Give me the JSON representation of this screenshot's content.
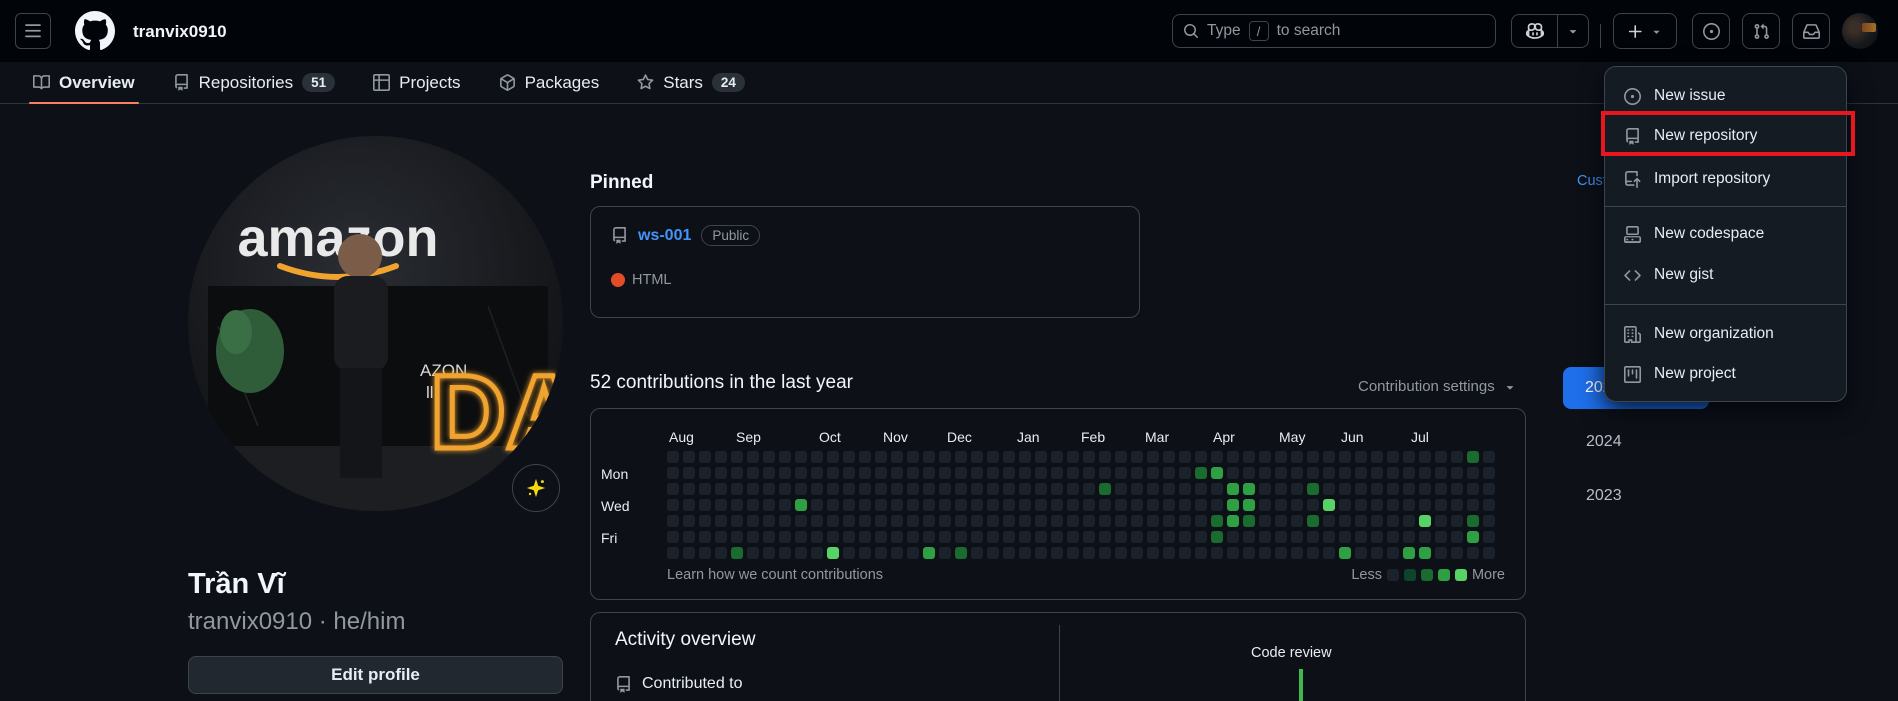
{
  "colors": {
    "page_bg": "#0d1117",
    "header_bg": "#010409",
    "border": "#3d444d",
    "link_blue": "#4493f8",
    "primary_blue": "#1f6feb",
    "tab_accent_orange": "#f78166",
    "html_lang_dot": "#e34c26",
    "highlight_red": "#e8161f",
    "code_review_green": "#3fb950"
  },
  "header": {
    "username": "tranvix0910",
    "search": {
      "prefix": "Type",
      "slash_key": "/",
      "suffix": "to search"
    },
    "icons": [
      "three-bars-icon",
      "github-mark-icon",
      "search-icon",
      "copilot-icon",
      "chevron-down-icon",
      "plus-icon",
      "issue-opened-icon",
      "git-pull-request-icon",
      "inbox-icon",
      "avatar"
    ]
  },
  "tabs": [
    {
      "label": "Overview",
      "icon": "book-icon",
      "active": true
    },
    {
      "label": "Repositories",
      "icon": "repo-icon",
      "count": "51",
      "active": false
    },
    {
      "label": "Projects",
      "icon": "table-icon",
      "active": false
    },
    {
      "label": "Packages",
      "icon": "package-icon",
      "active": false
    },
    {
      "label": "Stars",
      "icon": "star-icon",
      "count": "24",
      "active": false
    }
  ],
  "profile": {
    "name": "Trần Vĩ",
    "login_line": "tranvix0910 · he/him",
    "edit_button": "Edit profile",
    "status_icon": "sparkle-icon",
    "avatar_scene": {
      "brand_text": "amazon",
      "neon_text": "DA",
      "small_text": "AZON,",
      "small_text2": "ll"
    }
  },
  "pinned": {
    "title": "Pinned",
    "repo": {
      "name": "ws-001",
      "visibility": "Public",
      "language": "HTML",
      "language_color": "#e34c26"
    }
  },
  "contributions": {
    "title": "52 contributions in the last year",
    "settings_label": "Contribution settings",
    "months": [
      "Aug",
      "Sep",
      "Oct",
      "Nov",
      "Dec",
      "Jan",
      "Feb",
      "Mar",
      "Apr",
      "May",
      "Jun",
      "Jul"
    ],
    "day_labels": [
      "Mon",
      "Wed",
      "Fri"
    ],
    "footer_link": "Learn how we count contributions",
    "legend": {
      "less": "Less",
      "more": "More"
    },
    "level_colors": [
      "#1b222c",
      "#0e4429",
      "#196c2e",
      "#2ea043",
      "#56d364"
    ],
    "grid": {
      "weeks": 52,
      "days": 7,
      "cells": [
        {
          "week": 4,
          "day": 6,
          "level": 2
        },
        {
          "week": 8,
          "day": 3,
          "level": 3
        },
        {
          "week": 10,
          "day": 6,
          "level": 4
        },
        {
          "week": 16,
          "day": 6,
          "level": 3
        },
        {
          "week": 18,
          "day": 6,
          "level": 2
        },
        {
          "week": 27,
          "day": 2,
          "level": 2
        },
        {
          "week": 33,
          "day": 1,
          "level": 2
        },
        {
          "week": 34,
          "day": 1,
          "level": 3
        },
        {
          "week": 34,
          "day": 4,
          "level": 2
        },
        {
          "week": 34,
          "day": 5,
          "level": 2
        },
        {
          "week": 35,
          "day": 2,
          "level": 3
        },
        {
          "week": 35,
          "day": 3,
          "level": 3
        },
        {
          "week": 35,
          "day": 4,
          "level": 3
        },
        {
          "week": 36,
          "day": 2,
          "level": 3
        },
        {
          "week": 36,
          "day": 3,
          "level": 3
        },
        {
          "week": 36,
          "day": 4,
          "level": 2
        },
        {
          "week": 40,
          "day": 2,
          "level": 2
        },
        {
          "week": 40,
          "day": 4,
          "level": 2
        },
        {
          "week": 41,
          "day": 3,
          "level": 4
        },
        {
          "week": 42,
          "day": 6,
          "level": 3
        },
        {
          "week": 46,
          "day": 6,
          "level": 3
        },
        {
          "week": 47,
          "day": 4,
          "level": 4
        },
        {
          "week": 47,
          "day": 6,
          "level": 3
        },
        {
          "week": 50,
          "day": 0,
          "level": 2
        },
        {
          "week": 50,
          "day": 4,
          "level": 2
        },
        {
          "week": 50,
          "day": 5,
          "level": 3
        }
      ]
    }
  },
  "years_sidebar": {
    "customize_link": "Customize your pins",
    "years": [
      {
        "label": "2025",
        "active": true
      },
      {
        "label": "2024",
        "active": false
      },
      {
        "label": "2023",
        "active": false
      }
    ]
  },
  "activity": {
    "title": "Activity overview",
    "contributed_label": "Contributed to",
    "code_review_label": "Code review"
  },
  "menu": {
    "groups": [
      {
        "items": [
          {
            "icon": "issue-opened-icon",
            "label": "New issue",
            "highlighted": false
          },
          {
            "icon": "repo-icon",
            "label": "New repository",
            "highlighted": true
          },
          {
            "icon": "repo-push-icon",
            "label": "Import repository",
            "highlighted": false
          }
        ]
      },
      {
        "items": [
          {
            "icon": "codespaces-icon",
            "label": "New codespace",
            "highlighted": false
          },
          {
            "icon": "code-icon",
            "label": "New gist",
            "highlighted": false
          }
        ]
      },
      {
        "items": [
          {
            "icon": "organization-icon",
            "label": "New organization",
            "highlighted": false
          },
          {
            "icon": "project-icon",
            "label": "New project",
            "highlighted": false
          }
        ]
      }
    ]
  }
}
